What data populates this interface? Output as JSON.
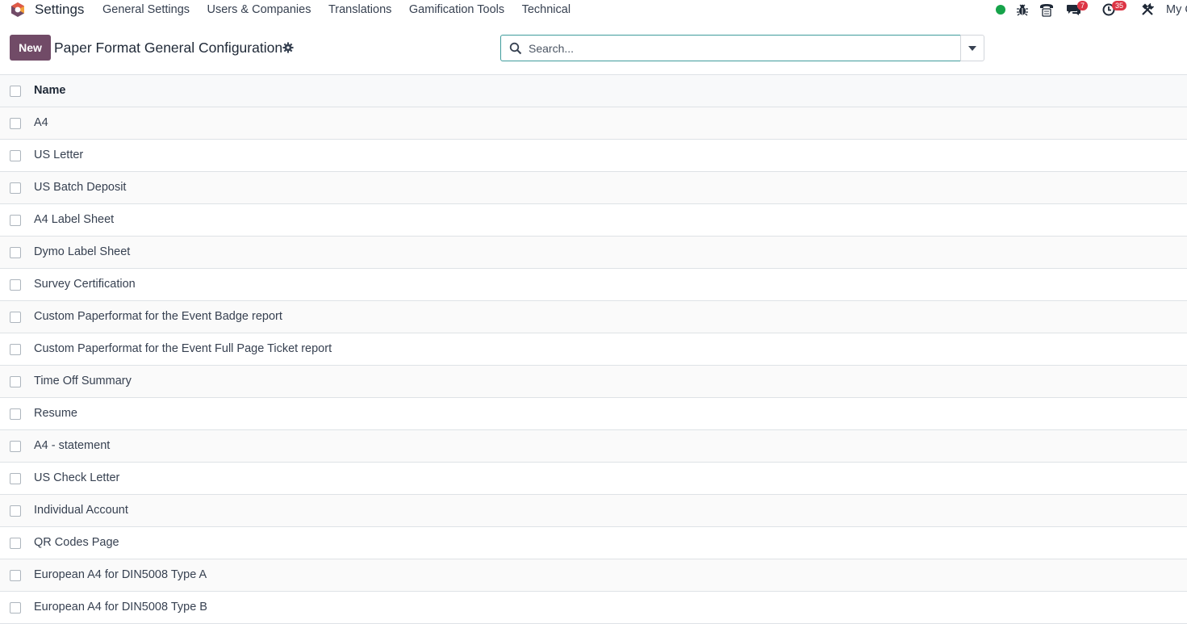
{
  "navbar": {
    "app_name": "Settings",
    "menu": [
      {
        "label": "General Settings"
      },
      {
        "label": "Users & Companies"
      },
      {
        "label": "Translations"
      },
      {
        "label": "Gamification Tools"
      },
      {
        "label": "Technical"
      }
    ],
    "systray": {
      "status_color": "#16a34a",
      "debug_icon": "bug-icon",
      "phone_icon": "phone-icon",
      "messages_icon": "chat-icon",
      "messages_count": "7",
      "activities_icon": "clock-icon",
      "activities_count": "35",
      "tools_icon": "tools-icon",
      "company_label": "My C"
    }
  },
  "control_panel": {
    "new_label": "New",
    "title": "Paper Format General Configuration",
    "settings_icon": "gear-icon",
    "search_placeholder": "Search...",
    "toggle_icon": "caret-down-icon"
  },
  "list": {
    "column_header": "Name",
    "rows": [
      "A4",
      "US Letter",
      "US Batch Deposit",
      "A4 Label Sheet",
      "Dymo Label Sheet",
      "Survey Certification",
      "Custom Paperformat for the Event Badge report",
      "Custom Paperformat for the Event Full Page Ticket report",
      "Time Off Summary",
      "Resume",
      "A4 - statement",
      "US Check Letter",
      "Individual Account",
      "QR Codes Page",
      "European A4 for DIN5008 Type A",
      "European A4 for DIN5008 Type B"
    ]
  },
  "colors": {
    "brand": "#714b67",
    "search_border": "#3f9c9c",
    "badge": "#dc3545"
  }
}
